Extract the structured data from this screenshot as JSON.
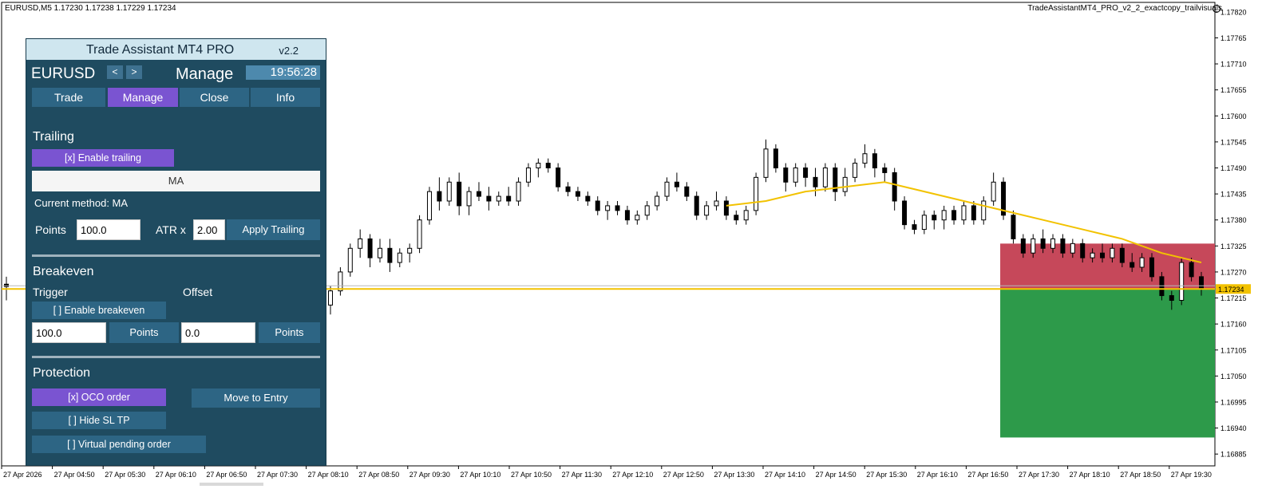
{
  "chart_header": {
    "symbol_line": "EURUSD,M5  1.17230 1.17238 1.17229 1.17234",
    "ea_name": "TradeAssistantMT4_PRO_v2_2_exactcopy_trailvisuals"
  },
  "panel": {
    "title": "Trade Assistant MT4 PRO",
    "version": "v2.2",
    "symbol": "EURUSD",
    "prev_label": "<",
    "next_label": ">",
    "mode": "Manage",
    "clock": "19:56:28",
    "tabs": [
      {
        "label": "Trade"
      },
      {
        "label": "Manage"
      },
      {
        "label": "Close"
      },
      {
        "label": "Info"
      }
    ],
    "trailing": {
      "title": "Trailing",
      "enable_label": "[x] Enable trailing",
      "method": "MA",
      "current_method": "Current method: MA",
      "points_label": "Points",
      "points_value": "100.0",
      "atr_label": "ATR x",
      "atr_value": "2.00",
      "apply_label": "Apply Trailing"
    },
    "breakeven": {
      "title": "Breakeven",
      "trigger_label": "Trigger",
      "offset_label": "Offset",
      "enable_label": "[ ] Enable breakeven",
      "trigger_value": "100.0",
      "trigger_points_label": "Points",
      "offset_value": "0.0",
      "offset_points_label": "Points"
    },
    "protection": {
      "title": "Protection",
      "oco_label": "[x] OCO order",
      "move_to_entry_label": "Move to Entry",
      "hide_sl_tp_label": "[ ] Hide SL TP",
      "virtual_pending_label": "[ ] Virtual pending order"
    }
  },
  "price_axis": {
    "ticks": [
      "1.17820",
      "1.17765",
      "1.17710",
      "1.17655",
      "1.17600",
      "1.17545",
      "1.17490",
      "1.17435",
      "1.17380",
      "1.17325",
      "1.17270",
      "1.17215",
      "1.17160",
      "1.17105",
      "1.17050",
      "1.16995",
      "1.16940",
      "1.16885"
    ],
    "current_price_label": "1.17234"
  },
  "time_axis": {
    "labels": [
      "27 Apr 2026",
      "27 Apr 04:50",
      "27 Apr 05:30",
      "27 Apr 06:10",
      "27 Apr 06:50",
      "27 Apr 07:30",
      "27 Apr 08:10",
      "27 Apr 08:50",
      "27 Apr 09:30",
      "27 Apr 10:10",
      "27 Apr 10:50",
      "27 Apr 11:30",
      "27 Apr 12:10",
      "27 Apr 12:50",
      "27 Apr 13:30",
      "27 Apr 14:10",
      "27 Apr 14:50",
      "27 Apr 15:30",
      "27 Apr 16:10",
      "27 Apr 16:50",
      "27 Apr 17:30",
      "27 Apr 18:10",
      "27 Apr 18:50",
      "27 Apr 19:30"
    ]
  },
  "colors": {
    "panel_bg": "#1f4b60",
    "accent_purple": "#7a54d1",
    "button_blue": "#2d6584",
    "ma_line": "#f2c200",
    "sl_zone": "#c6485a",
    "tp_zone": "#2d9a4a"
  },
  "trade_levels": {
    "entry_price": 1.17234,
    "sl_price": 1.1733,
    "tp_price": 1.1692
  },
  "chart_data": {
    "type": "candlestick",
    "symbol": "EURUSD",
    "timeframe": "M5",
    "ylim": [
      1.1687,
      1.1785
    ],
    "candles": [
      {
        "o": 1.172,
        "h": 1.1724,
        "l": 1.1718,
        "c": 1.1723
      },
      {
        "o": 1.1723,
        "h": 1.1728,
        "l": 1.1722,
        "c": 1.1727
      },
      {
        "o": 1.1727,
        "h": 1.1733,
        "l": 1.1726,
        "c": 1.1732
      },
      {
        "o": 1.1732,
        "h": 1.1736,
        "l": 1.173,
        "c": 1.1734
      },
      {
        "o": 1.1734,
        "h": 1.1735,
        "l": 1.1728,
        "c": 1.173
      },
      {
        "o": 1.173,
        "h": 1.1734,
        "l": 1.1729,
        "c": 1.1732
      },
      {
        "o": 1.1732,
        "h": 1.1734,
        "l": 1.1727,
        "c": 1.1729
      },
      {
        "o": 1.1729,
        "h": 1.1732,
        "l": 1.1728,
        "c": 1.1731
      },
      {
        "o": 1.1731,
        "h": 1.1733,
        "l": 1.1729,
        "c": 1.1732
      },
      {
        "o": 1.1732,
        "h": 1.1739,
        "l": 1.1731,
        "c": 1.1738
      },
      {
        "o": 1.1738,
        "h": 1.1745,
        "l": 1.1737,
        "c": 1.1744
      },
      {
        "o": 1.1744,
        "h": 1.1747,
        "l": 1.174,
        "c": 1.1742
      },
      {
        "o": 1.1742,
        "h": 1.1747,
        "l": 1.1741,
        "c": 1.1746
      },
      {
        "o": 1.1746,
        "h": 1.1748,
        "l": 1.1739,
        "c": 1.1741
      },
      {
        "o": 1.1741,
        "h": 1.1745,
        "l": 1.1739,
        "c": 1.1744
      },
      {
        "o": 1.1744,
        "h": 1.1746,
        "l": 1.1742,
        "c": 1.1743
      },
      {
        "o": 1.1743,
        "h": 1.1745,
        "l": 1.174,
        "c": 1.1742
      },
      {
        "o": 1.1742,
        "h": 1.1744,
        "l": 1.1741,
        "c": 1.1743
      },
      {
        "o": 1.1743,
        "h": 1.1745,
        "l": 1.1741,
        "c": 1.1742
      },
      {
        "o": 1.1742,
        "h": 1.1747,
        "l": 1.1741,
        "c": 1.1746
      },
      {
        "o": 1.1746,
        "h": 1.175,
        "l": 1.1745,
        "c": 1.1749
      },
      {
        "o": 1.1749,
        "h": 1.1751,
        "l": 1.1747,
        "c": 1.175
      },
      {
        "o": 1.175,
        "h": 1.1751,
        "l": 1.1748,
        "c": 1.1749
      },
      {
        "o": 1.1749,
        "h": 1.175,
        "l": 1.1744,
        "c": 1.1745
      },
      {
        "o": 1.1745,
        "h": 1.1746,
        "l": 1.1743,
        "c": 1.1744
      },
      {
        "o": 1.1744,
        "h": 1.1745,
        "l": 1.1742,
        "c": 1.1743
      },
      {
        "o": 1.1743,
        "h": 1.1744,
        "l": 1.1741,
        "c": 1.1742
      },
      {
        "o": 1.1742,
        "h": 1.1743,
        "l": 1.1739,
        "c": 1.174
      },
      {
        "o": 1.174,
        "h": 1.1742,
        "l": 1.1738,
        "c": 1.1741
      },
      {
        "o": 1.1741,
        "h": 1.1742,
        "l": 1.1739,
        "c": 1.174
      },
      {
        "o": 1.174,
        "h": 1.1741,
        "l": 1.1737,
        "c": 1.1738
      },
      {
        "o": 1.1738,
        "h": 1.174,
        "l": 1.1737,
        "c": 1.1739
      },
      {
        "o": 1.1739,
        "h": 1.1742,
        "l": 1.1738,
        "c": 1.1741
      },
      {
        "o": 1.1741,
        "h": 1.1744,
        "l": 1.174,
        "c": 1.1743
      },
      {
        "o": 1.1743,
        "h": 1.1747,
        "l": 1.1742,
        "c": 1.1746
      },
      {
        "o": 1.1746,
        "h": 1.1748,
        "l": 1.1744,
        "c": 1.1745
      },
      {
        "o": 1.1745,
        "h": 1.1746,
        "l": 1.1742,
        "c": 1.1743
      },
      {
        "o": 1.1743,
        "h": 1.1744,
        "l": 1.1738,
        "c": 1.1739
      },
      {
        "o": 1.1739,
        "h": 1.1742,
        "l": 1.1738,
        "c": 1.1741
      },
      {
        "o": 1.1741,
        "h": 1.1744,
        "l": 1.174,
        "c": 1.1742
      },
      {
        "o": 1.1742,
        "h": 1.1743,
        "l": 1.1738,
        "c": 1.1739
      },
      {
        "o": 1.1739,
        "h": 1.174,
        "l": 1.1737,
        "c": 1.1738
      },
      {
        "o": 1.1738,
        "h": 1.1741,
        "l": 1.1737,
        "c": 1.174
      },
      {
        "o": 1.174,
        "h": 1.1748,
        "l": 1.1739,
        "c": 1.1747
      },
      {
        "o": 1.1747,
        "h": 1.1755,
        "l": 1.1746,
        "c": 1.1753
      },
      {
        "o": 1.1753,
        "h": 1.1754,
        "l": 1.1748,
        "c": 1.1749
      },
      {
        "o": 1.1749,
        "h": 1.175,
        "l": 1.1744,
        "c": 1.1746
      },
      {
        "o": 1.1746,
        "h": 1.175,
        "l": 1.1745,
        "c": 1.1749
      },
      {
        "o": 1.1749,
        "h": 1.175,
        "l": 1.1745,
        "c": 1.1747
      },
      {
        "o": 1.1747,
        "h": 1.1749,
        "l": 1.1743,
        "c": 1.1745
      },
      {
        "o": 1.1745,
        "h": 1.175,
        "l": 1.1744,
        "c": 1.1749
      },
      {
        "o": 1.1749,
        "h": 1.175,
        "l": 1.1742,
        "c": 1.1744
      },
      {
        "o": 1.1744,
        "h": 1.1749,
        "l": 1.1743,
        "c": 1.1747
      },
      {
        "o": 1.1747,
        "h": 1.1751,
        "l": 1.1746,
        "c": 1.175
      },
      {
        "o": 1.175,
        "h": 1.1754,
        "l": 1.1749,
        "c": 1.1752
      },
      {
        "o": 1.1752,
        "h": 1.1753,
        "l": 1.1747,
        "c": 1.1749
      },
      {
        "o": 1.1749,
        "h": 1.175,
        "l": 1.1746,
        "c": 1.1748
      },
      {
        "o": 1.1748,
        "h": 1.1749,
        "l": 1.174,
        "c": 1.1742
      },
      {
        "o": 1.1742,
        "h": 1.1743,
        "l": 1.1736,
        "c": 1.1737
      },
      {
        "o": 1.1737,
        "h": 1.1738,
        "l": 1.1735,
        "c": 1.1736
      },
      {
        "o": 1.1736,
        "h": 1.174,
        "l": 1.1735,
        "c": 1.1739
      },
      {
        "o": 1.1739,
        "h": 1.174,
        "l": 1.1736,
        "c": 1.1738
      },
      {
        "o": 1.1738,
        "h": 1.1741,
        "l": 1.1736,
        "c": 1.174
      },
      {
        "o": 1.174,
        "h": 1.1741,
        "l": 1.1737,
        "c": 1.1738
      },
      {
        "o": 1.1738,
        "h": 1.1742,
        "l": 1.1737,
        "c": 1.1741
      },
      {
        "o": 1.1741,
        "h": 1.1742,
        "l": 1.1737,
        "c": 1.1738
      },
      {
        "o": 1.1738,
        "h": 1.1743,
        "l": 1.1737,
        "c": 1.1742
      },
      {
        "o": 1.1742,
        "h": 1.1748,
        "l": 1.1741,
        "c": 1.1746
      },
      {
        "o": 1.1746,
        "h": 1.1747,
        "l": 1.1738,
        "c": 1.1739
      },
      {
        "o": 1.1739,
        "h": 1.174,
        "l": 1.1733,
        "c": 1.1734
      },
      {
        "o": 1.1734,
        "h": 1.1735,
        "l": 1.173,
        "c": 1.1731
      },
      {
        "o": 1.1731,
        "h": 1.1735,
        "l": 1.173,
        "c": 1.1734
      },
      {
        "o": 1.1734,
        "h": 1.1736,
        "l": 1.1731,
        "c": 1.1732
      },
      {
        "o": 1.1732,
        "h": 1.1735,
        "l": 1.1731,
        "c": 1.1734
      },
      {
        "o": 1.1734,
        "h": 1.1735,
        "l": 1.173,
        "c": 1.1731
      },
      {
        "o": 1.1731,
        "h": 1.1734,
        "l": 1.173,
        "c": 1.1733
      },
      {
        "o": 1.1733,
        "h": 1.1734,
        "l": 1.1729,
        "c": 1.173
      },
      {
        "o": 1.173,
        "h": 1.1732,
        "l": 1.1729,
        "c": 1.1731
      },
      {
        "o": 1.1731,
        "h": 1.1733,
        "l": 1.1729,
        "c": 1.173
      },
      {
        "o": 1.173,
        "h": 1.1733,
        "l": 1.1729,
        "c": 1.1732
      },
      {
        "o": 1.1732,
        "h": 1.1733,
        "l": 1.1728,
        "c": 1.1729
      },
      {
        "o": 1.1729,
        "h": 1.1731,
        "l": 1.1727,
        "c": 1.1728
      },
      {
        "o": 1.1728,
        "h": 1.1731,
        "l": 1.1727,
        "c": 1.173
      },
      {
        "o": 1.173,
        "h": 1.1731,
        "l": 1.1725,
        "c": 1.1726
      },
      {
        "o": 1.1726,
        "h": 1.1727,
        "l": 1.1721,
        "c": 1.1722
      },
      {
        "o": 1.1722,
        "h": 1.1723,
        "l": 1.1719,
        "c": 1.1721
      },
      {
        "o": 1.1721,
        "h": 1.173,
        "l": 1.172,
        "c": 1.1729
      },
      {
        "o": 1.1729,
        "h": 1.173,
        "l": 1.1725,
        "c": 1.1726
      },
      {
        "o": 1.1726,
        "h": 1.1727,
        "l": 1.1722,
        "c": 1.17234
      }
    ],
    "ma_series": [
      {
        "i": 40,
        "v": 1.1741
      },
      {
        "i": 44,
        "v": 1.1742
      },
      {
        "i": 48,
        "v": 1.1744
      },
      {
        "i": 52,
        "v": 1.1745
      },
      {
        "i": 56,
        "v": 1.1746
      },
      {
        "i": 60,
        "v": 1.1744
      },
      {
        "i": 64,
        "v": 1.1742
      },
      {
        "i": 68,
        "v": 1.174
      },
      {
        "i": 72,
        "v": 1.1738
      },
      {
        "i": 76,
        "v": 1.1736
      },
      {
        "i": 80,
        "v": 1.1734
      },
      {
        "i": 84,
        "v": 1.1731
      },
      {
        "i": 88,
        "v": 1.1729
      }
    ]
  }
}
